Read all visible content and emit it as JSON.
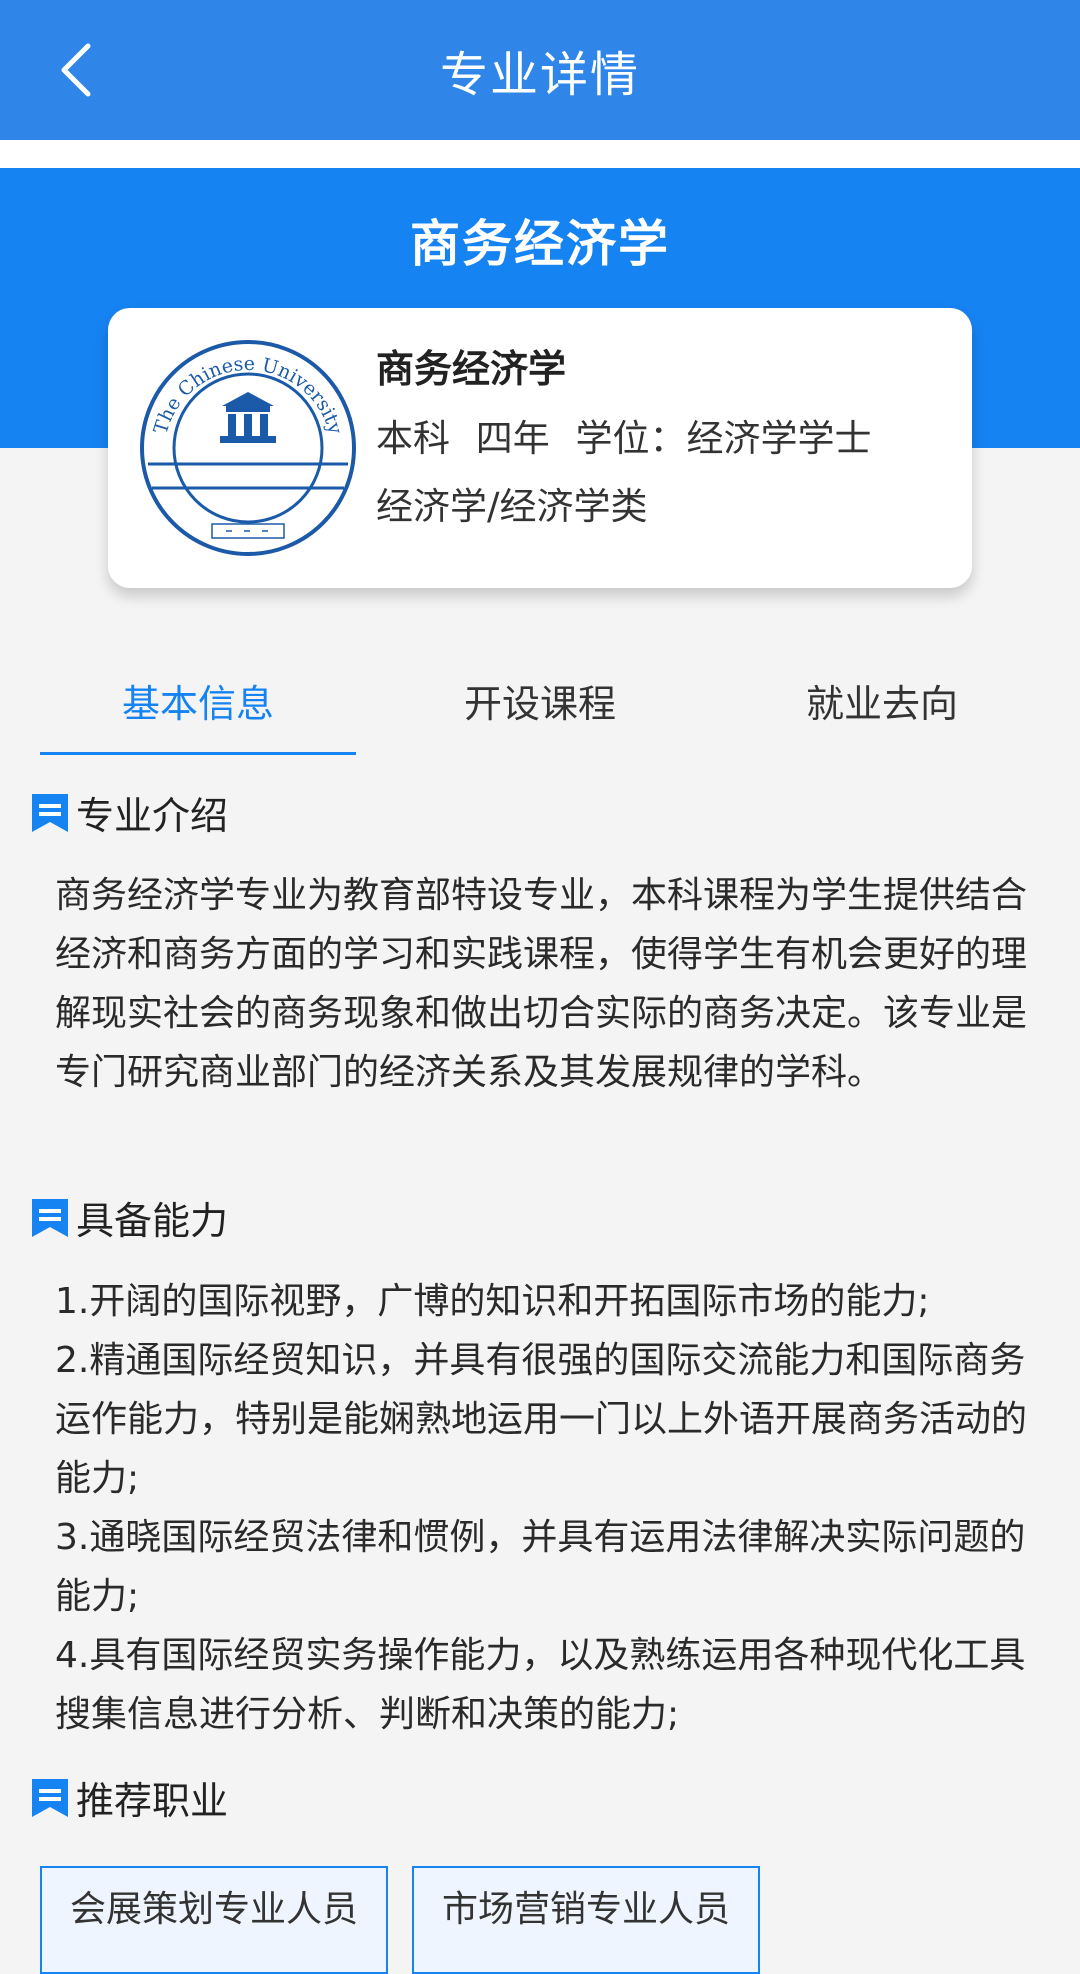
{
  "header": {
    "title": "专业详情",
    "back_icon": "chevron-left-icon"
  },
  "hero": {
    "title": "商务经济学"
  },
  "major_card": {
    "logo_text": "The Chinese University",
    "name": "商务经济学",
    "level": "本科",
    "duration": "四年",
    "degree": "学位：经济学学士",
    "category": "经济学/经济学类"
  },
  "tabs": [
    {
      "label": "基本信息",
      "active": true
    },
    {
      "label": "开设课程",
      "active": false
    },
    {
      "label": "就业去向",
      "active": false
    }
  ],
  "intro": {
    "heading": "专业介绍",
    "text": "商务经济学专业为教育部特设专业，本科课程为学生提供结合经济和商务方面的学习和实践课程，使得学生有机会更好的理解现实社会的商务现象和做出切合实际的商务决定。该专业是专门研究商业部门的经济关系及其发展规律的学科。"
  },
  "abilities": {
    "heading": "具备能力",
    "items": [
      "1.开阔的国际视野，广博的知识和开拓国际市场的能力;",
      "2.精通国际经贸知识，并具有很强的国际交流能力和国际商务运作能力，特别是能娴熟地运用一门以上外语开展商务活动的能力;",
      "3.通晓国际经贸法律和惯例，并具有运用法律解决实际问题的能力;",
      "4.具有国际经贸实务操作能力，以及熟练运用各种现代化工具搜集信息进行分析、判断和决策的能力;"
    ]
  },
  "careers": {
    "heading": "推荐职业",
    "items": [
      "会展策划专业人员",
      "市场营销专业人员"
    ]
  },
  "colors": {
    "header_bg": "#2f86e8",
    "accent": "#1683f2",
    "page_bg": "#f4f4f4"
  }
}
